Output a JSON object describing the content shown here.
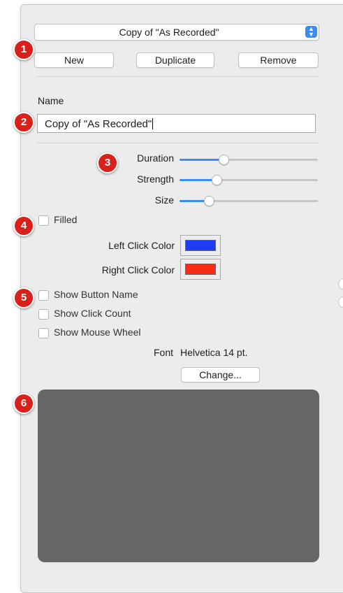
{
  "preset_popup": {
    "selected": "Copy of \"As Recorded\""
  },
  "buttons": {
    "new": "New",
    "duplicate": "Duplicate",
    "remove": "Remove",
    "change": "Change..."
  },
  "name_section": {
    "label": "Name",
    "value": "Copy of \"As Recorded\""
  },
  "sliders": [
    {
      "label": "Duration",
      "value": 0.32
    },
    {
      "label": "Strength",
      "value": 0.27
    },
    {
      "label": "Size",
      "value": 0.21
    }
  ],
  "filled": {
    "label": "Filled",
    "checked": false
  },
  "colors": {
    "left_label": "Left Click Color",
    "left_value": "#1f3cf5",
    "right_label": "Right Click Color",
    "right_value": "#f52a17"
  },
  "options": [
    {
      "label": "Show Button Name",
      "checked": false
    },
    {
      "label": "Show Click Count",
      "checked": false
    },
    {
      "label": "Show Mouse Wheel",
      "checked": false
    }
  ],
  "font": {
    "label": "Font",
    "value": "Helvetica 14 pt."
  },
  "preview": {
    "color": "#666666"
  },
  "badges": [
    "1",
    "2",
    "3",
    "4",
    "5",
    "6"
  ]
}
